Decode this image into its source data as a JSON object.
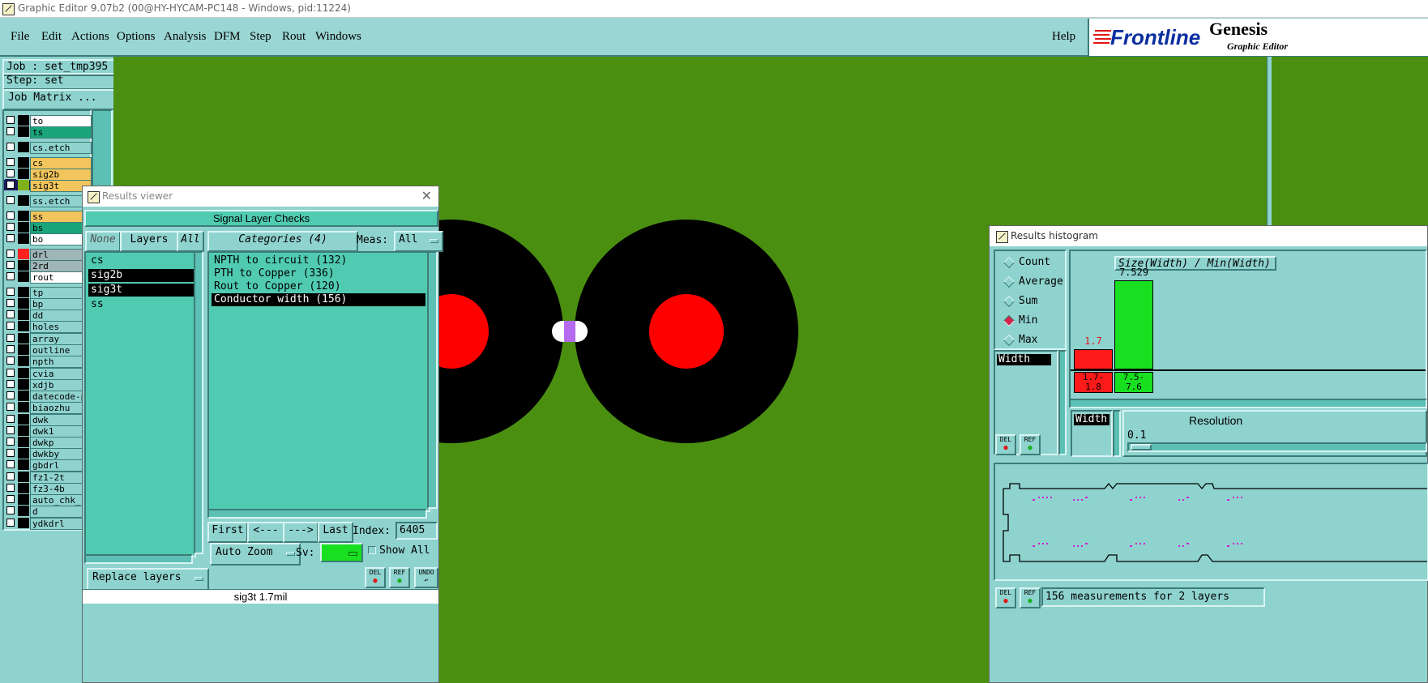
{
  "window": {
    "title": "Graphic Editor 9.07b2 (00@HY-HYCAM-PC148 - Windows, pid:11224)"
  },
  "menu": [
    "File",
    "Edit",
    "Actions",
    "Options",
    "Analysis",
    "DFM",
    "Step",
    "Rout",
    "Windows"
  ],
  "help": "Help",
  "logo": {
    "brand": "Frontline",
    "product": "Genesis",
    "sub": "Graphic Editor"
  },
  "job": {
    "job_label": "Job : set_tmp395",
    "step_label": "Step: set",
    "matrix_button": "Job Matrix ..."
  },
  "layers": [
    {
      "name": "to",
      "swatch": "#000000",
      "bg": "#ffffff"
    },
    {
      "name": "ts",
      "swatch": "#000000",
      "bg": "#1aa57a"
    },
    {
      "name": "cs.etch",
      "swatch": "#000000",
      "bg": "#8fd3cf"
    },
    {
      "name": "cs",
      "swatch": "#000000",
      "bg": "#f2c65c"
    },
    {
      "name": "sig2b",
      "swatch": "#000000",
      "bg": "#f2c65c"
    },
    {
      "name": "sig3t",
      "swatch": "#7fb21a",
      "bg": "#f2c65c",
      "selected": true
    },
    {
      "name": "ss.etch",
      "swatch": "#000000",
      "bg": "#8fd3cf"
    },
    {
      "name": "ss",
      "swatch": "#000000",
      "bg": "#f2c65c"
    },
    {
      "name": "bs",
      "swatch": "#000000",
      "bg": "#1aa57a"
    },
    {
      "name": "bo",
      "swatch": "#000000",
      "bg": "#ffffff"
    },
    {
      "name": "drl",
      "swatch": "#ff2020",
      "bg": "#9fb5b8"
    },
    {
      "name": "2rd",
      "swatch": "#000000",
      "bg": "#9fb5b8"
    },
    {
      "name": "rout",
      "swatch": "#000000",
      "bg": "#ffffff"
    },
    {
      "name": "tp",
      "swatch": "#000000",
      "bg": "#8fd3cf"
    },
    {
      "name": "bp",
      "swatch": "#000000",
      "bg": "#8fd3cf"
    },
    {
      "name": "dd",
      "swatch": "#000000",
      "bg": "#8fd3cf"
    },
    {
      "name": "holes",
      "swatch": "#000000",
      "bg": "#8fd3cf"
    },
    {
      "name": "array",
      "swatch": "#000000",
      "bg": "#8fd3cf"
    },
    {
      "name": "outline",
      "swatch": "#000000",
      "bg": "#8fd3cf"
    },
    {
      "name": "npth",
      "swatch": "#000000",
      "bg": "#8fd3cf"
    },
    {
      "name": "cvia",
      "swatch": "#000000",
      "bg": "#8fd3cf"
    },
    {
      "name": "xdjb",
      "swatch": "#000000",
      "bg": "#8fd3cf"
    },
    {
      "name": "datecode-p",
      "swatch": "#000000",
      "bg": "#8fd3cf"
    },
    {
      "name": "biaozhu",
      "swatch": "#000000",
      "bg": "#8fd3cf"
    },
    {
      "name": "dwk",
      "swatch": "#000000",
      "bg": "#8fd3cf"
    },
    {
      "name": "dwk1",
      "swatch": "#000000",
      "bg": "#8fd3cf"
    },
    {
      "name": "dwkp",
      "swatch": "#000000",
      "bg": "#8fd3cf"
    },
    {
      "name": "dwkby",
      "swatch": "#000000",
      "bg": "#8fd3cf"
    },
    {
      "name": "gbdrl",
      "swatch": "#000000",
      "bg": "#8fd3cf"
    },
    {
      "name": "fz1-2t",
      "swatch": "#000000",
      "bg": "#8fd3cf"
    },
    {
      "name": "fz3-4b",
      "swatch": "#000000",
      "bg": "#8fd3cf"
    },
    {
      "name": "auto_chk_",
      "swatch": "#000000",
      "bg": "#8fd3cf"
    },
    {
      "name": "d",
      "swatch": "#000000",
      "bg": "#8fd3cf"
    },
    {
      "name": "ydkdrl",
      "swatch": "#000000",
      "bg": "#8fd3cf"
    }
  ],
  "results_viewer": {
    "title": "Results viewer",
    "heading": "Signal Layer Checks",
    "none_btn": "None",
    "layers_btn": "Layers",
    "all_btn": "All",
    "categories_btn": "Categories (4)",
    "meas_label": "Meas:",
    "meas_value": "All",
    "layer_list": [
      {
        "name": "cs",
        "selected": false
      },
      {
        "name": "sig2b",
        "selected": true
      },
      {
        "name": "sig3t",
        "selected": true
      },
      {
        "name": "ss",
        "selected": false
      }
    ],
    "categories": [
      {
        "name": "NPTH to circuit (132)",
        "selected": false
      },
      {
        "name": "PTH to Copper (336)",
        "selected": false
      },
      {
        "name": "Rout to Copper (120)",
        "selected": false
      },
      {
        "name": "Conductor width (156)",
        "selected": true
      }
    ],
    "first_btn": "First",
    "prev_btn": "<---",
    "next_btn": "--->",
    "last_btn": "Last",
    "index_label": "Index:",
    "index_value": "6405",
    "auto_zoom": "Auto Zoom",
    "sv_label": "Sv:",
    "show_all": "Show All",
    "replace_layers": "Replace layers",
    "del": "DEL",
    "ref": "REF",
    "undo": "UNDO",
    "status": "sig3t 1.7mil"
  },
  "histogram": {
    "title": "Results histogram",
    "modes": [
      {
        "label": "Count",
        "on": false
      },
      {
        "label": "Average",
        "on": false
      },
      {
        "label": "Sum",
        "on": false
      },
      {
        "label": "Min",
        "on": true
      },
      {
        "label": "Max",
        "on": false
      }
    ],
    "field": "Width",
    "chart_title": "Size(Width) / Min(Width)",
    "bars": [
      {
        "value": "1.7",
        "range_top": "1.7-",
        "range_bot": "1.8",
        "color": "#ff1a1a",
        "level": 0.23
      },
      {
        "value": "7.529",
        "range_top": "7.5-",
        "range_bot": "7.6",
        "color": "#18e020",
        "level": 1.0
      }
    ],
    "resolution_label": "Resolution",
    "resolution_value": "0.1",
    "field2": "Width",
    "del": "DEL",
    "ref": "REF",
    "summary": "156 measurements for 2 layers"
  },
  "colors": {
    "board": "#4b8f11",
    "pad": "#000000",
    "drill": "#ff0000",
    "panel": "#8fd3cf",
    "list": "#50cbb2"
  }
}
